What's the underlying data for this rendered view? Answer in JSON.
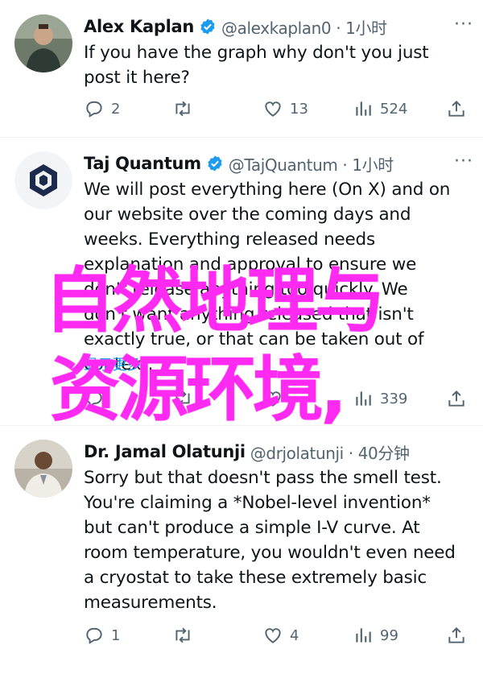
{
  "tweets": [
    {
      "name": "Alex Kaplan",
      "handle": "@alexkaplan0 · 1小时",
      "text": "If you have the graph why don't you just\npost it here?",
      "replies": "2",
      "retweets": "",
      "likes": "13",
      "views": "524"
    },
    {
      "name": "Taj Quantum",
      "handle": "@TajQuantum · 1小时",
      "text": "We will post everything here (On X) and on\nour website over the coming days and\nweeks. Everything released needs\nexplanation and approval to ensure we\ndon't release anything too quickly. We\ndon't want anything released that isn't\nexactly true, or that can be taken out of\ncontext.",
      "show_more": "显示更多",
      "replies": "",
      "retweets": "",
      "likes": "",
      "views": "339"
    },
    {
      "name": "Dr. Jamal Olatunji",
      "handle": "@drjolatunji · 40分钟",
      "text": "Sorry but that doesn't pass the smell test.\nYou're claiming a *Nobel-level invention*\nbut can't produce a simple I-V curve. At\nroom temperature, you wouldn't even need\na cryostat to take these extremely basic\nmeasurements.",
      "replies": "1",
      "retweets": "",
      "likes": "4",
      "views": "99"
    }
  ],
  "overlay": {
    "line1": "自然地理与",
    "line2": "资源环境,"
  },
  "colors": {
    "accent": "#1d9bf0",
    "overlay": "#ff2af2",
    "muted": "#536471"
  }
}
